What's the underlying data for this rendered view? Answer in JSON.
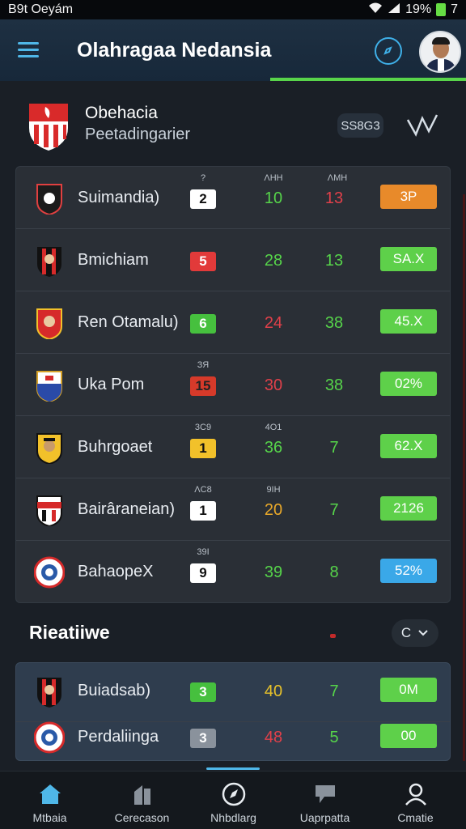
{
  "status_bar": {
    "time": "B9t Oeyám",
    "battery_text": "19%",
    "signal": "7"
  },
  "app_bar": {
    "title": "Olahragaa Nedansia"
  },
  "team": {
    "name": "Obehacia",
    "subtitle": "Peetadingarier",
    "season": "SS8G3"
  },
  "standings": [
    {
      "name": "Suimandia)",
      "position": "2",
      "pos_color": "#ffffff",
      "pos_text": "#111111",
      "labels": [
        "?",
        "ΛΗΗ",
        "ΛΜΗ"
      ],
      "stat1": "10",
      "stat1_color": "#56d44a",
      "stat2": "13",
      "stat2_color": "#e0404a",
      "pill": "3P",
      "pill_color": "#e88a2a",
      "crest": "crest-black"
    },
    {
      "name": "Bmichiam",
      "position": "5",
      "pos_color": "#e23a3a",
      "pos_text": "#ffffff",
      "labels": [
        "",
        "",
        ""
      ],
      "stat1": "28",
      "stat1_color": "#56d44a",
      "stat2": "13",
      "stat2_color": "#56d44a",
      "pill": "SA.X",
      "pill_color": "#5ed04a",
      "crest": "crest-redblack"
    },
    {
      "name": "Ren Otamalu)",
      "position": "6",
      "pos_color": "#46c03e",
      "pos_text": "#ffffff",
      "labels": [
        "",
        "",
        ""
      ],
      "stat1": "24",
      "stat1_color": "#e0404a",
      "stat2": "38",
      "stat2_color": "#56d44a",
      "pill": "45.X",
      "pill_color": "#5ed04a",
      "crest": "crest-red"
    },
    {
      "name": "Uka Pom",
      "position": "15",
      "pos_color": "#d63a2a",
      "pos_text": "#222222",
      "labels": [
        "ЗЯ",
        "",
        ""
      ],
      "stat1": "30",
      "stat1_color": "#e0404a",
      "stat2": "38",
      "stat2_color": "#56d44a",
      "pill": "02%",
      "pill_color": "#5ed04a",
      "crest": "crest-blue"
    },
    {
      "name": "Buhrgoaet",
      "position": "1",
      "pos_color": "#f2c12a",
      "pos_text": "#111111",
      "labels": [
        "3C9",
        "4O1",
        ""
      ],
      "stat1": "36",
      "stat1_color": "#56d44a",
      "stat2": "7",
      "stat2_color": "#56d44a",
      "pill": "62.X",
      "pill_color": "#5ed04a",
      "crest": "crest-yellow"
    },
    {
      "name": "Bairâraneian)",
      "position": "1",
      "pos_color": "#ffffff",
      "pos_text": "#111111",
      "labels": [
        "ΛC8",
        "9ΙΗ",
        ""
      ],
      "stat1": "20",
      "stat1_color": "#e8a82a",
      "stat2": "7",
      "stat2_color": "#56d44a",
      "pill": "2126",
      "pill_color": "#5ed04a",
      "crest": "crest-redwhite"
    },
    {
      "name": "BahaopeX",
      "position": "9",
      "pos_color": "#ffffff",
      "pos_text": "#111111",
      "labels": [
        "39Ι",
        "",
        ""
      ],
      "stat1": "39",
      "stat1_color": "#56d44a",
      "stat2": "8",
      "stat2_color": "#56d44a",
      "pill": "52%",
      "pill_color": "#3aa8e8",
      "crest": "crest-round"
    }
  ],
  "section": {
    "title": "Rieatiiwe",
    "refresh_label": "C"
  },
  "related": [
    {
      "name": "Buiadsab)",
      "position": "3",
      "pos_color": "#46c03e",
      "pos_text": "#ffffff",
      "stat1": "40",
      "stat1_color": "#e8c22a",
      "stat2": "7",
      "stat2_color": "#56d44a",
      "pill": "0M",
      "pill_color": "#5ed04a"
    },
    {
      "name": "Perdaliinga",
      "position": "3",
      "pos_color": "#8a929c",
      "pos_text": "#ffffff",
      "stat1": "48",
      "stat1_color": "#e0404a",
      "stat2": "5",
      "stat2_color": "#56d44a",
      "pill": "00",
      "pill_color": "#5ed04a"
    }
  ],
  "nav": [
    {
      "label": "Mtbaia",
      "icon": "home-icon"
    },
    {
      "label": "Cerecason",
      "icon": "stats-icon"
    },
    {
      "label": "Nhbdlarg",
      "icon": "compass-icon"
    },
    {
      "label": "Uaprpatta",
      "icon": "chat-icon"
    },
    {
      "label": "Cmatie",
      "icon": "profile-icon"
    }
  ],
  "colors": {
    "accent": "#4fb7e8",
    "green": "#5ed04a",
    "red": "#e0404a",
    "background": "#1a1f26"
  }
}
